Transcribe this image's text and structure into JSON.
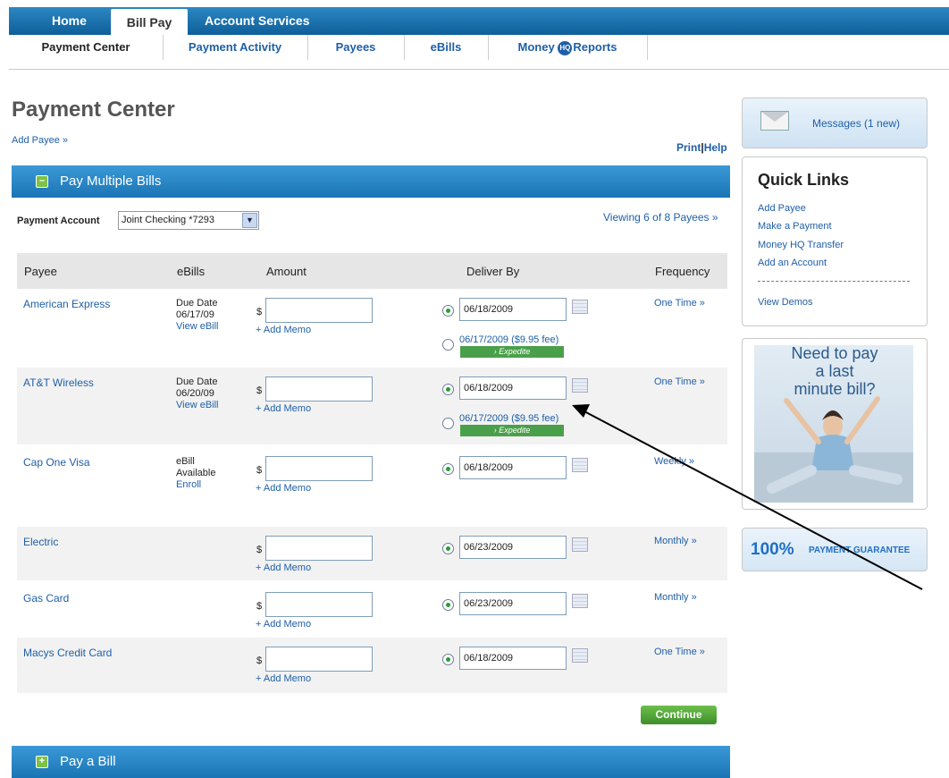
{
  "nav": {
    "tabs": [
      {
        "label": "Home"
      },
      {
        "label": "Bill Pay"
      },
      {
        "label": "Account Services"
      }
    ],
    "sub": [
      {
        "label": "Payment Center"
      },
      {
        "label": "Payment Activity"
      },
      {
        "label": "Payees"
      },
      {
        "label": "eBills"
      },
      {
        "label": "Money ",
        "badge": "HQ",
        "suffix": "Reports"
      }
    ]
  },
  "page": {
    "title": "Payment Center",
    "add_payee": "Add Payee »",
    "print": "Print",
    "help": "Help",
    "sep": "|"
  },
  "pay_multiple": {
    "title": "Pay Multiple Bills",
    "icon": "minus-icon",
    "account_label": "Payment Account",
    "account_value": "Joint Checking *7293",
    "viewing": "Viewing 6 of 8 Payees »",
    "headers": {
      "payee": "Payee",
      "ebills": "eBills",
      "amount": "Amount",
      "deliver_by": "Deliver By",
      "frequency": "Frequency"
    },
    "rows": [
      {
        "payee": "American Express",
        "ebill_1": "Due Date",
        "ebill_2": "06/17/09",
        "ebill_link": "View eBill",
        "dollar": "$",
        "memo": "+ Add Memo",
        "date": "06/18/2009",
        "alt_date": "06/17/2009 ($9.95 fee)",
        "expedite": "› Expedite",
        "freq": "One Time »"
      },
      {
        "payee": "AT&T Wireless",
        "ebill_1": "Due Date",
        "ebill_2": "06/20/09",
        "ebill_link": "View eBill",
        "dollar": "$",
        "memo": "+ Add Memo",
        "date": "06/18/2009",
        "alt_date": "06/17/2009 ($9.95 fee)",
        "expedite": "› Expedite",
        "freq": "One Time »"
      },
      {
        "payee": "Cap One Visa",
        "ebill_1": "eBill",
        "ebill_2": "Available",
        "ebill_link": "Enroll",
        "dollar": "$",
        "memo": "+ Add Memo",
        "date": "06/18/2009",
        "freq": "Weekly »"
      },
      {
        "payee": "Electric",
        "dollar": "$",
        "memo": "+ Add Memo",
        "date": "06/23/2009",
        "freq": "Monthly »"
      },
      {
        "payee": "Gas Card",
        "dollar": "$",
        "memo": "+ Add Memo",
        "date": "06/23/2009",
        "freq": "Monthly »"
      },
      {
        "payee": "Macys Credit Card",
        "dollar": "$",
        "memo": "+ Add Memo",
        "date": "06/18/2009",
        "freq": "One Time »"
      }
    ],
    "continue": "Continue"
  },
  "pay_bill": {
    "title": "Pay a Bill",
    "icon": "plus-icon"
  },
  "sidebar": {
    "messages": "Messages (1 new)",
    "quick_links_title": "Quick Links",
    "quick_links": [
      "Add Payee",
      "Make a Payment",
      "Money HQ Transfer",
      "Add an Account"
    ],
    "demos": "View Demos",
    "ad_line1": "Need to pay",
    "ad_line2": "a last",
    "ad_line3": "minute bill?",
    "guarantee_big": "100%",
    "guarantee_small": "PAYMENT GUARANTEE"
  },
  "colors": {
    "accent": "#1a74b5",
    "link": "#1f5fa8",
    "button_green": "#4aa04a"
  }
}
